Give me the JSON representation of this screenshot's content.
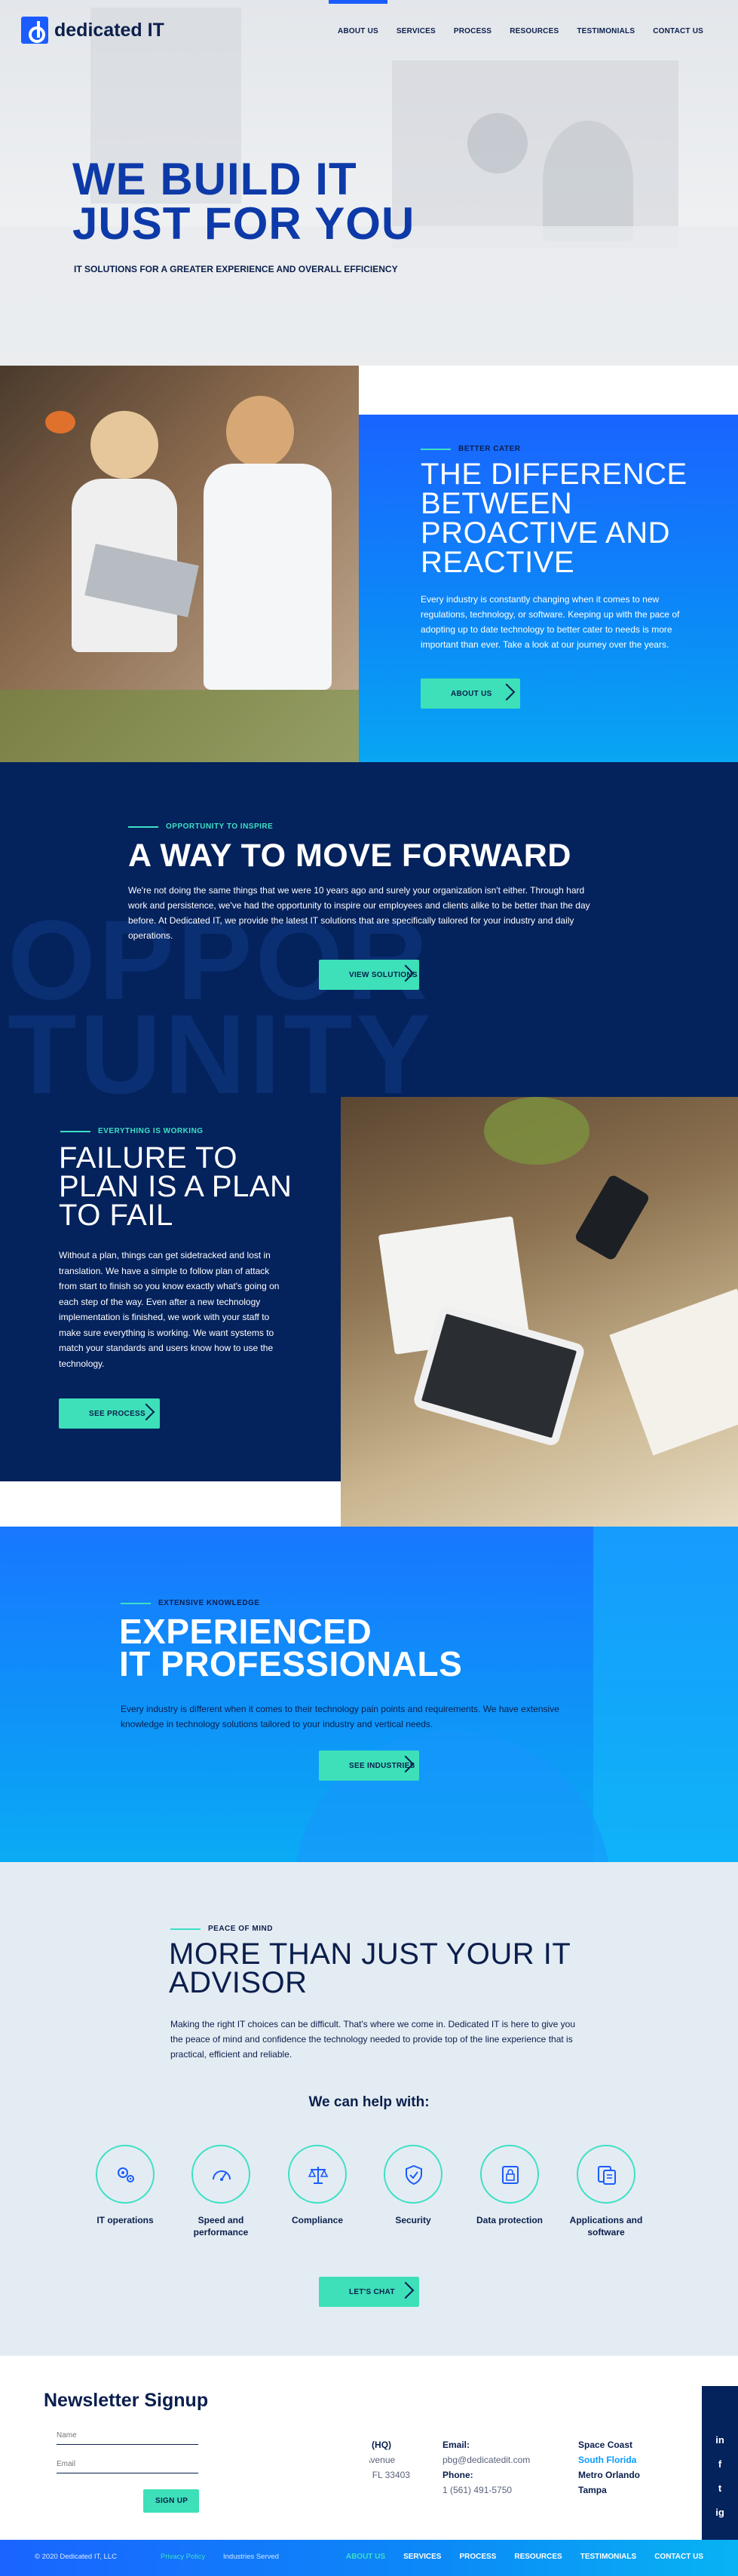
{
  "brand": {
    "name": "dedicated IT"
  },
  "nav": {
    "items": [
      "ABOUT US",
      "SERVICES",
      "PROCESS",
      "RESOURCES",
      "TESTIMONIALS",
      "CONTACT US"
    ],
    "active": "ABOUT US"
  },
  "hero": {
    "title_line1": "WE BUILD IT",
    "title_line2": "JUST FOR YOU",
    "subtitle": "IT SOLUTIONS FOR A GREATER EXPERIENCE AND OVERALL EFFICIENCY"
  },
  "difference": {
    "eyebrow": "BETTER CATER",
    "title": "THE DIFFERENCE BETWEEN PROACTIVE AND REACTIVE",
    "body": "Every industry is constantly changing when it comes to new regulations, technology, or software. Keeping up with the pace of adopting up to date technology to better cater to needs is more important than ever. Take a look at our journey over the years.",
    "button": "ABOUT US"
  },
  "opportunity": {
    "eyebrow": "OPPORTUNITY TO INSPIRE",
    "title": "A WAY TO MOVE FORWARD",
    "body": "We're not doing the same things that we were 10 years ago and surely your organization isn't either. Through hard work and persistence, we've had the opportunity to inspire our employees and clients alike to be better than the day before. At Dedicated IT, we provide the latest IT solutions that are specifically tailored for your industry and daily operations.",
    "button": "VIEW SOLUTIONS",
    "ghost_line1": "OPPOR",
    "ghost_line2": "TUNITY"
  },
  "failure": {
    "eyebrow": "EVERYTHING IS WORKING",
    "title": "FAILURE TO PLAN IS A PLAN TO FAIL",
    "body": "Without a plan, things can get sidetracked and lost in translation. We have a simple to follow plan of attack from start to finish so you know exactly what's going on each step of the way. Even after a new technology implementation is finished, we work with your staff to make sure everything is working. We want systems to match your standards and users know how to use the technology.",
    "button": "SEE PROCESS"
  },
  "experienced": {
    "eyebrow": "EXTENSIVE KNOWLEDGE",
    "title_line1": "EXPERIENCED",
    "title_line2": "IT PROFESSIONALS",
    "body": "Every industry is different when it comes to their technology pain points and requirements. We have extensive knowledge in technology solutions tailored to your industry and vertical needs.",
    "button": "SEE INDUSTRIES"
  },
  "advisor": {
    "eyebrow": "PEACE OF MIND",
    "title": "MORE THAN JUST YOUR IT ADVISOR",
    "body": "Making the right IT choices can be difficult. That's where we come in. Dedicated IT is here to give you the peace of mind and confidence the technology needed to provide top of the line experience that is practical, efficient and reliable.",
    "help_heading": "We can help with:",
    "services": [
      {
        "label": "IT operations",
        "icon": "gears-icon"
      },
      {
        "label": "Speed and performance",
        "icon": "speedometer-icon"
      },
      {
        "label": "Compliance",
        "icon": "scales-icon"
      },
      {
        "label": "Security",
        "icon": "shield-icon"
      },
      {
        "label": "Data protection",
        "icon": "lock-icon"
      },
      {
        "label": "Applications and software",
        "icon": "applications-icon"
      }
    ],
    "button": "LET'S CHAT"
  },
  "newsletter": {
    "title": "Newsletter Signup",
    "name_label": "Name",
    "email_label": "Email",
    "button": "SIGN UP"
  },
  "footer": {
    "location_title": "Lake Park (HQ)",
    "address_line1": "754 Park Avenue",
    "address_line2": "Lake Park, FL 33403",
    "email_title": "Email:",
    "email": "pbg@dedicatedit.com",
    "phone_title": "Phone:",
    "phone": "1 (561) 491-5750",
    "areas": [
      "Space Coast",
      "South Florida",
      "Metro Orlando",
      "Tampa"
    ],
    "highlighted_area": "South Florida",
    "social": [
      "in",
      "f",
      "t",
      "ig"
    ]
  },
  "bottom_bar": {
    "copyright": "© 2020 Dedicated IT, LLC",
    "privacy": "Privacy Policy",
    "industries": "Industries Served",
    "nav": [
      "ABOUT US",
      "SERVICES",
      "PROCESS",
      "RESOURCES",
      "TESTIMONIALS",
      "CONTACT US"
    ]
  },
  "colors": {
    "navy": "#04225C",
    "brand_blue": "#1A5CFF",
    "accent_teal": "#3DE0B8",
    "text_dark": "#0B1F4D"
  }
}
